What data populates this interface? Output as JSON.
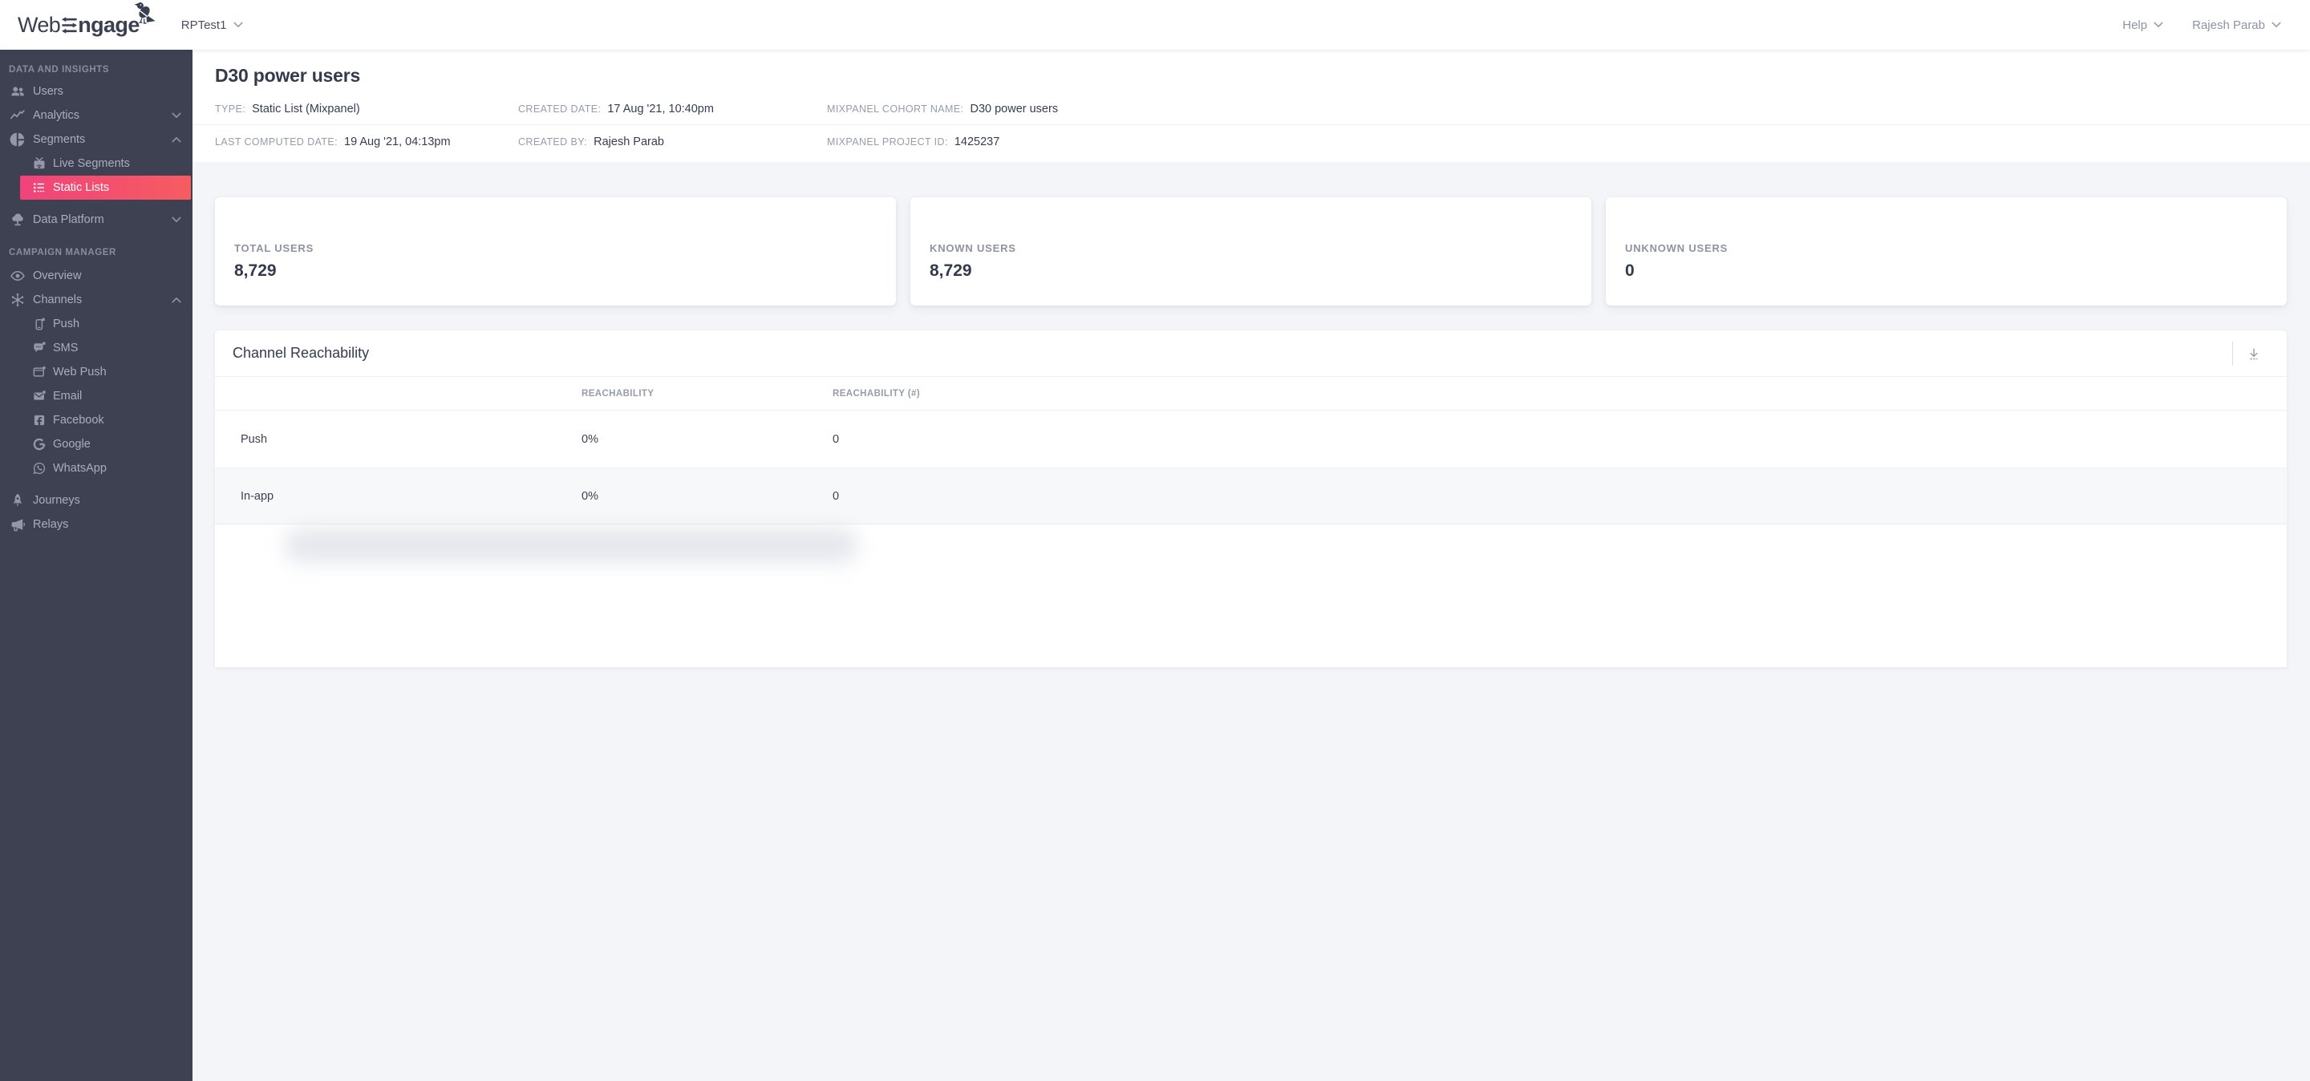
{
  "topbar": {
    "logo_web": "Web",
    "logo_ngage": "ngage",
    "project": "RPTest1",
    "help": "Help",
    "user": "Rajesh Parab"
  },
  "sidebar": {
    "sections": [
      {
        "header": "DATA AND INSIGHTS",
        "items": [
          {
            "label": "Users",
            "icon": "users-icon"
          },
          {
            "label": "Analytics",
            "icon": "analytics-icon",
            "chevron": "down"
          },
          {
            "label": "Segments",
            "icon": "segments-icon",
            "chevron": "up",
            "children": [
              {
                "label": "Live Segments",
                "icon": "live-segments-icon"
              },
              {
                "label": "Static Lists",
                "icon": "static-lists-icon",
                "active": true
              }
            ]
          },
          {
            "label": "Data Platform",
            "icon": "data-platform-icon",
            "chevron": "down"
          }
        ]
      },
      {
        "header": "CAMPAIGN MANAGER",
        "items": [
          {
            "label": "Overview",
            "icon": "overview-icon"
          },
          {
            "label": "Channels",
            "icon": "channels-icon",
            "chevron": "up",
            "children": [
              {
                "label": "Push",
                "icon": "push-icon"
              },
              {
                "label": "SMS",
                "icon": "sms-icon"
              },
              {
                "label": "Web Push",
                "icon": "web-push-icon"
              },
              {
                "label": "Email",
                "icon": "email-icon"
              },
              {
                "label": "Facebook",
                "icon": "facebook-icon"
              },
              {
                "label": "Google",
                "icon": "google-icon"
              },
              {
                "label": "WhatsApp",
                "icon": "whatsapp-icon"
              }
            ]
          },
          {
            "label": "Journeys",
            "icon": "journeys-icon"
          },
          {
            "label": "Relays",
            "icon": "relays-icon"
          }
        ]
      }
    ]
  },
  "page": {
    "title": "D30 power users",
    "meta": [
      [
        {
          "label": "TYPE:",
          "value": "Static List (Mixpanel)"
        },
        {
          "label": "CREATED DATE:",
          "value": "17 Aug '21, 10:40pm"
        },
        {
          "label": "MIXPANEL COHORT NAME:",
          "value": "D30 power users"
        }
      ],
      [
        {
          "label": "LAST COMPUTED DATE:",
          "value": "19 Aug '21, 04:13pm"
        },
        {
          "label": "CREATED BY:",
          "value": "Rajesh Parab"
        },
        {
          "label": "MIXPANEL PROJECT ID:",
          "value": "1425237"
        }
      ]
    ]
  },
  "stats": [
    {
      "label": "TOTAL USERS",
      "value": "8,729"
    },
    {
      "label": "KNOWN USERS",
      "value": "8,729"
    },
    {
      "label": "UNKNOWN USERS",
      "value": "0"
    }
  ],
  "reachability": {
    "title": "Channel Reachability",
    "download_icon": "download-icon",
    "columns": [
      "REACHABILITY",
      "REACHABILITY (#)"
    ],
    "rows": [
      {
        "channel": "Push",
        "reachability": "0%",
        "count": "0"
      },
      {
        "channel": "In-app",
        "reachability": "0%",
        "count": "0"
      }
    ]
  },
  "colors": {
    "accent_gradient_start": "#f0437b",
    "accent_gradient_end": "#f65c60",
    "sidebar_bg": "#3d4152",
    "page_bg": "#f4f5f8",
    "text_dark": "#333a4d",
    "text_gray": "#8d93a0"
  }
}
